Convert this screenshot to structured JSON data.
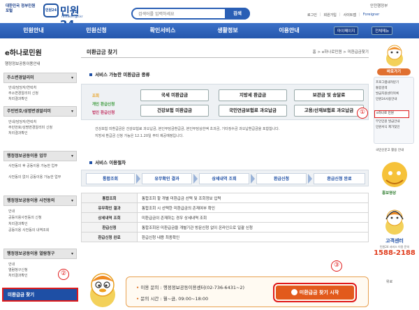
{
  "header": {
    "gov_logo": "대한민국 정부민원포털",
    "brand": "민원24",
    "brand_badge": "민원24",
    "brand_url": "minwon.go.kr",
    "search_placeholder": "검색어를 입력하세요",
    "search_button": "검색",
    "gov_label": "안전행정부",
    "util_links": [
      "로그인",
      "회원가입",
      "사이트맵",
      "Foreigner"
    ]
  },
  "nav": {
    "items": [
      "민원안내",
      "민원신청",
      "확인서비스",
      "생활정보",
      "이용안내"
    ],
    "my_page": "마이페이지",
    "full_menu": "전체메뉴"
  },
  "sidebar": {
    "title": "e하나로민원",
    "subtitle": "행정정보공동이용안내",
    "sections": [
      {
        "label": "주소변경알리미",
        "links": [
          "안내/담당자/연락처",
          "주소변경알리미 신청",
          "처리결과확인"
        ]
      },
      {
        "label": "주민번호/성명변경알리미",
        "links": [
          "안내/담당자/연락처",
          "주민번호/성명변경알리미 신청",
          "처리결과확인"
        ]
      },
      {
        "label": "행정정보공동이용 업무",
        "links": [
          "사전동의 후 공동이용 가능한 업무",
          "사전동의 없이 공동이용 가능한 업무"
        ]
      },
      {
        "label": "행정정보공동이용 사전동의",
        "links": [
          "안내",
          "공동이용사전동의 신청",
          "처리결과확인",
          "공동이용 사전동의 내역조회"
        ]
      },
      {
        "label": "행정정보공동이용 열람청구",
        "links": [
          "안내",
          "열람청구신청",
          "처리결과확인"
        ]
      }
    ],
    "active_item": "미환급금 찾기"
  },
  "main": {
    "page_title": "미환급금 찾기",
    "breadcrumb": "홈 > e하나로민원 > 미환급금찾기",
    "service_heading": "서비스 가능한 미환급금 종류",
    "legend": [
      "조회",
      "개인 환급신청",
      "법인 환급신청"
    ],
    "refunds": [
      "국세 미환급금",
      "지방세 환급금",
      "보관금 및 송달료",
      "건강보험 미환급금",
      "국민연금보험료 과오납금",
      "고용/산재보험료 과오납금"
    ],
    "notes": [
      "건강보험 미환급금은 건강보험료 과오납금, 본인부담금환급금, 본인부담상한액 초과금, 기타징수금 과오납환급금을 포함합니다.",
      "지방세 환급금 신청 가능은 12.1.20일 부터 제공예정입니다."
    ],
    "procedure_heading": "서비스 이용절차",
    "steps": [
      "통합조회",
      "유무확인 결과",
      "상세내역 조회",
      "환급신청",
      "환급신청 완료"
    ],
    "table": [
      {
        "k": "통합조회",
        "v": "통합조회 할 개별 미환급금 선택 및 조회정보 입력"
      },
      {
        "k": "유무확인 결과",
        "v": "통합조회 시 선택한 미환급금의 존재여부 확인"
      },
      {
        "k": "상세내역 조회",
        "v": "미환급금이 존재하는 경우 상세내역 조회"
      },
      {
        "k": "환급신청",
        "v": "통합조회된 미환급금을 개별기관 방문신청 없이 온라인으로 일괄 신청"
      },
      {
        "k": "환급신청 완료",
        "v": "환급신청 내용 최종확인"
      }
    ],
    "contact_inquiry": "이용 문의 : 행정정보공동이용센터(02-736-6431~2)",
    "contact_hours": "문의 시간 : 월~금, 09:00~18:00",
    "start_button": "미환급금 찾기 시작"
  },
  "rightbar": {
    "quick_title": "바로가기",
    "links": [
      "프로그램내려받기",
      "통합검색",
      "발급지원센터목록",
      "민원24사용안내"
    ],
    "highlight": "e하나로 민원",
    "links2": [
      "무인민원 발급안내",
      "민원서식 제가찾인"
    ],
    "sub_link": "국민신문고 활용 안내",
    "promo": "홍보영상",
    "call_title": "고객센터",
    "call_sub": "민원24 서비스 이용 문의",
    "call_number": "1588-2188",
    "top": "위로"
  },
  "marks": [
    "①",
    "②",
    "③"
  ],
  "colors": {
    "nav": "#2457ad",
    "accent": "#e25a1c",
    "mark": "#e01919",
    "view": "#e8a020",
    "personal": "#3a9a3a",
    "corp": "#c03060"
  }
}
